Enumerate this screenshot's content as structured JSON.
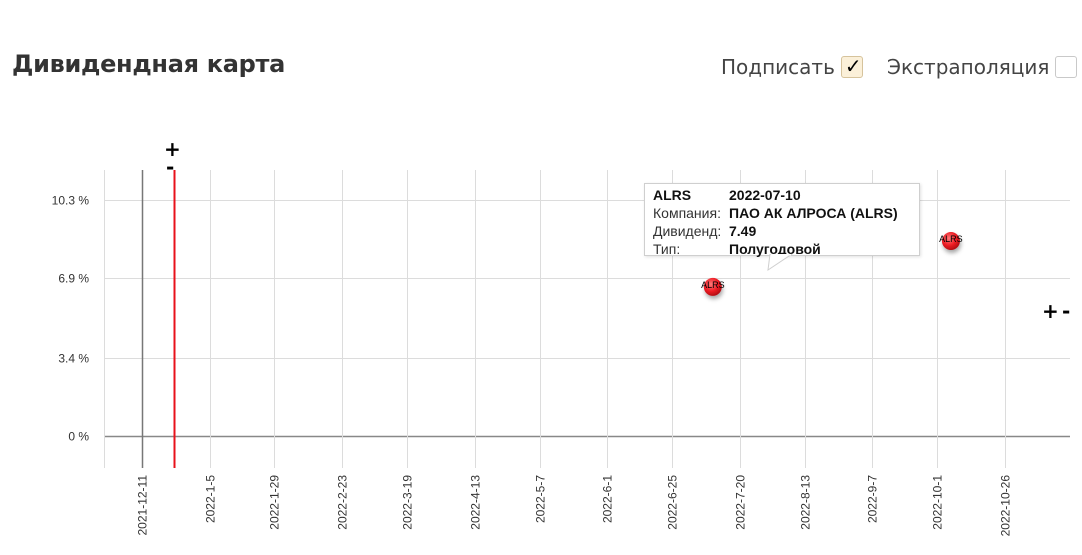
{
  "title": "Дивидендная карта",
  "controls": {
    "sign_label": "Подписать",
    "sign_checked": true,
    "extrapolation_label": "Экстраполяция",
    "extrapolation_checked": false
  },
  "zoom": {
    "plus": "+",
    "minus": "-"
  },
  "tooltip": {
    "ticker": "ALRS",
    "date": "2022-07-10",
    "company_label": "Компания:",
    "company": "ПАО АК АЛРОСА (ALRS)",
    "dividend_label": "Дивиденд:",
    "dividend": "7.49",
    "type_label": "Тип:",
    "type": "Полугодовой"
  },
  "chart_data": {
    "type": "scatter",
    "x_ticks": [
      "2021-12-11",
      "2022-1-5",
      "2022-1-29",
      "2022-2-23",
      "2022-3-19",
      "2022-4-13",
      "2022-5-7",
      "2022-6-1",
      "2022-6-25",
      "2022-7-20",
      "2022-8-13",
      "2022-9-7",
      "2022-10-1",
      "2022-10-26"
    ],
    "y_ticks": [
      {
        "value": 0,
        "label": "0 %"
      },
      {
        "value": 3.4,
        "label": "3.4 %"
      },
      {
        "value": 6.9,
        "label": "6.9 %"
      },
      {
        "value": 10.3,
        "label": "10.3 %"
      }
    ],
    "xlim": [
      "2021-11-27",
      "2022-11-19"
    ],
    "ylim": [
      -1.4,
      11.6
    ],
    "today_marker": "2021-12-23",
    "grid": true,
    "points": [
      {
        "date": "2022-07-10",
        "value": 6.5,
        "label": "ALRS",
        "color": "#e8121b"
      },
      {
        "date": "2022-10-06",
        "value": 8.5,
        "label": "ALRS",
        "color": "#e8121b"
      }
    ]
  }
}
